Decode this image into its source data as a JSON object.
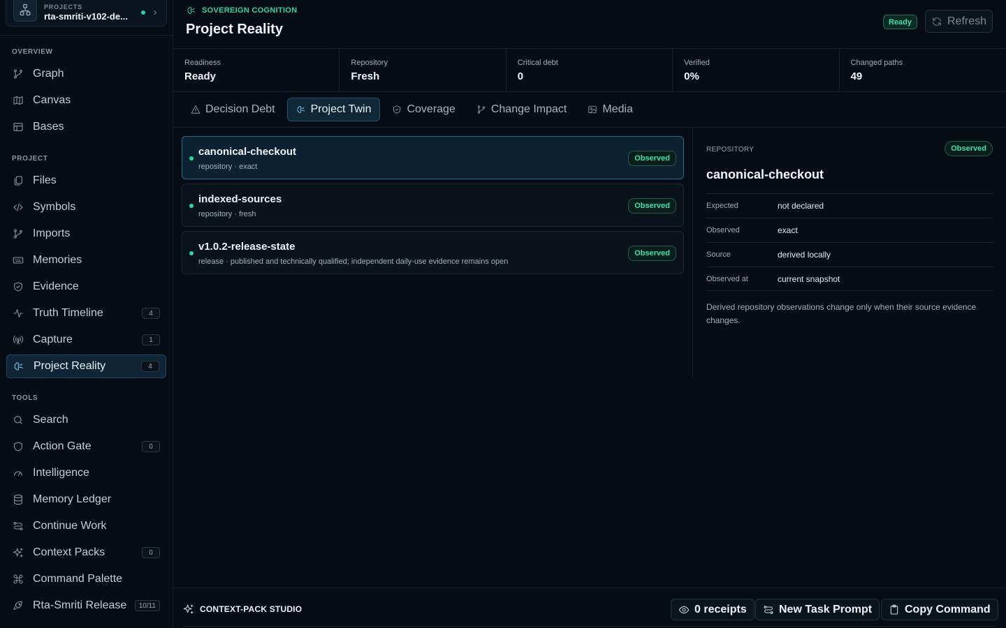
{
  "sidebar": {
    "project": {
      "kicker": "PROJECTS",
      "name": "rta-smriti-v102-de..."
    },
    "sections": [
      {
        "label": "OVERVIEW",
        "items": [
          {
            "label": "Graph",
            "icon": "graph-icon"
          },
          {
            "label": "Canvas",
            "icon": "map-icon"
          },
          {
            "label": "Bases",
            "icon": "table-icon"
          }
        ]
      },
      {
        "label": "PROJECT",
        "items": [
          {
            "label": "Files",
            "icon": "files-icon"
          },
          {
            "label": "Symbols",
            "icon": "code-icon"
          },
          {
            "label": "Imports",
            "icon": "branch-icon"
          },
          {
            "label": "Memories",
            "icon": "keyboard-icon"
          },
          {
            "label": "Evidence",
            "icon": "shield-check-icon"
          },
          {
            "label": "Truth Timeline",
            "icon": "activity-icon",
            "badge": "4"
          },
          {
            "label": "Capture",
            "icon": "radio-icon",
            "badge": "1"
          },
          {
            "label": "Project Reality",
            "icon": "brain-icon",
            "badge": "4",
            "active": true
          }
        ]
      },
      {
        "label": "TOOLS",
        "items": [
          {
            "label": "Search",
            "icon": "search-icon"
          },
          {
            "label": "Action Gate",
            "icon": "shield-icon",
            "badge": "0"
          },
          {
            "label": "Intelligence",
            "icon": "gauge-icon"
          },
          {
            "label": "Memory Ledger",
            "icon": "database-icon"
          },
          {
            "label": "Continue Work",
            "icon": "route-icon"
          },
          {
            "label": "Context Packs",
            "icon": "sparkles-icon",
            "badge": "0"
          },
          {
            "label": "Command Palette",
            "icon": "command-icon"
          },
          {
            "label": "Rta-Smriti Release",
            "icon": "rocket-icon",
            "badge": "10/11"
          }
        ]
      }
    ]
  },
  "header": {
    "kicker": "SOVEREIGN COGNITION",
    "title": "Project Reality",
    "status": "Ready",
    "refresh_label": "Refresh"
  },
  "stats": [
    {
      "label": "Readiness",
      "value": "Ready"
    },
    {
      "label": "Repository",
      "value": "Fresh"
    },
    {
      "label": "Critical debt",
      "value": "0"
    },
    {
      "label": "Verified",
      "value": "0%"
    },
    {
      "label": "Changed paths",
      "value": "49"
    }
  ],
  "tabs": [
    {
      "label": "Decision Debt",
      "icon": "alert-triangle-icon"
    },
    {
      "label": "Project Twin",
      "icon": "brain-icon",
      "active": true
    },
    {
      "label": "Coverage",
      "icon": "shield-check-icon"
    },
    {
      "label": "Change Impact",
      "icon": "branch-icon"
    },
    {
      "label": "Media",
      "icon": "image-icon"
    }
  ],
  "observations": [
    {
      "title": "canonical-checkout",
      "subtitle": "repository · exact",
      "status": "Observed",
      "selected": true
    },
    {
      "title": "indexed-sources",
      "subtitle": "repository · fresh",
      "status": "Observed"
    },
    {
      "title": "v1.0.2-release-state",
      "subtitle": "release · published and technically qualified; independent daily-use evidence remains open",
      "status": "Observed"
    }
  ],
  "detail": {
    "kicker": "REPOSITORY",
    "status": "Observed",
    "title": "canonical-checkout",
    "rows": [
      {
        "key": "Expected",
        "value": "not declared"
      },
      {
        "key": "Observed",
        "value": "exact"
      },
      {
        "key": "Source",
        "value": "derived locally"
      },
      {
        "key": "Observed at",
        "value": "current snapshot"
      }
    ],
    "note": "Derived repository observations change only when their source evidence changes."
  },
  "footer": {
    "title": "CONTEXT-PACK STUDIO",
    "receipts_label": "0 receipts",
    "new_task_label": "New Task Prompt",
    "copy_label": "Copy Command"
  },
  "colors": {
    "background": "#050c14",
    "accent_green": "#2fd6a4",
    "accent_blue": "#7cc6ea",
    "active_bg": "#0f2535"
  }
}
